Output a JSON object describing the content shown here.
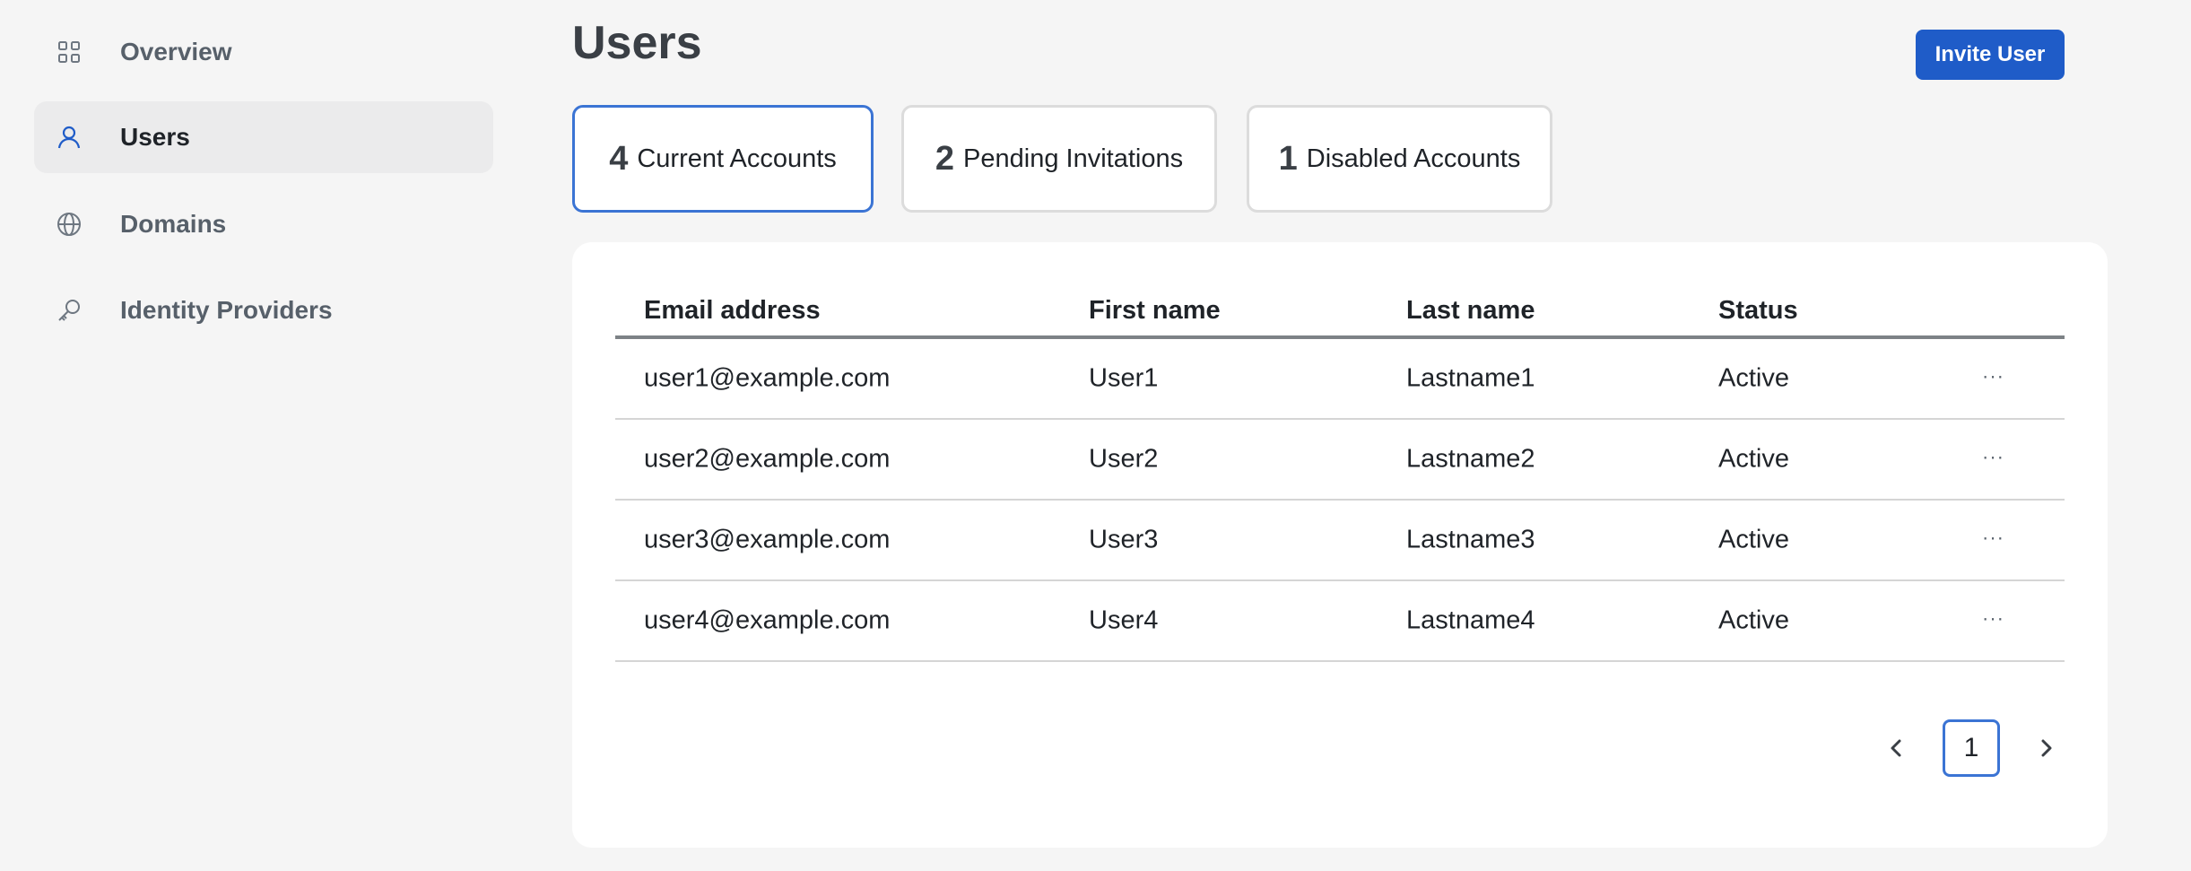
{
  "sidebar": {
    "items": [
      {
        "label": "Overview",
        "icon": "grid-icon",
        "active": false
      },
      {
        "label": "Users",
        "icon": "user-icon",
        "active": true
      },
      {
        "label": "Domains",
        "icon": "globe-icon",
        "active": false
      },
      {
        "label": "Identity Providers",
        "icon": "key-icon",
        "active": false
      }
    ]
  },
  "header": {
    "title": "Users",
    "invite_label": "Invite User"
  },
  "tabs": [
    {
      "count": "4",
      "label": "Current Accounts",
      "active": true
    },
    {
      "count": "2",
      "label": "Pending Invitations",
      "active": false
    },
    {
      "count": "1",
      "label": "Disabled Accounts",
      "active": false
    }
  ],
  "table": {
    "columns": [
      "Email address",
      "First name",
      "Last name",
      "Status"
    ],
    "rows": [
      {
        "email": "user1@example.com",
        "first": "User1",
        "last": "Lastname1",
        "status": "Active"
      },
      {
        "email": "user2@example.com",
        "first": "User2",
        "last": "Lastname2",
        "status": "Active"
      },
      {
        "email": "user3@example.com",
        "first": "User3",
        "last": "Lastname3",
        "status": "Active"
      },
      {
        "email": "user4@example.com",
        "first": "User4",
        "last": "Lastname4",
        "status": "Active"
      }
    ],
    "more_label": "···"
  },
  "pagination": {
    "current_page": "1"
  },
  "colors": {
    "accent": "#1f5cc8",
    "active_border": "#3b74d4",
    "background": "#f5f5f5"
  }
}
